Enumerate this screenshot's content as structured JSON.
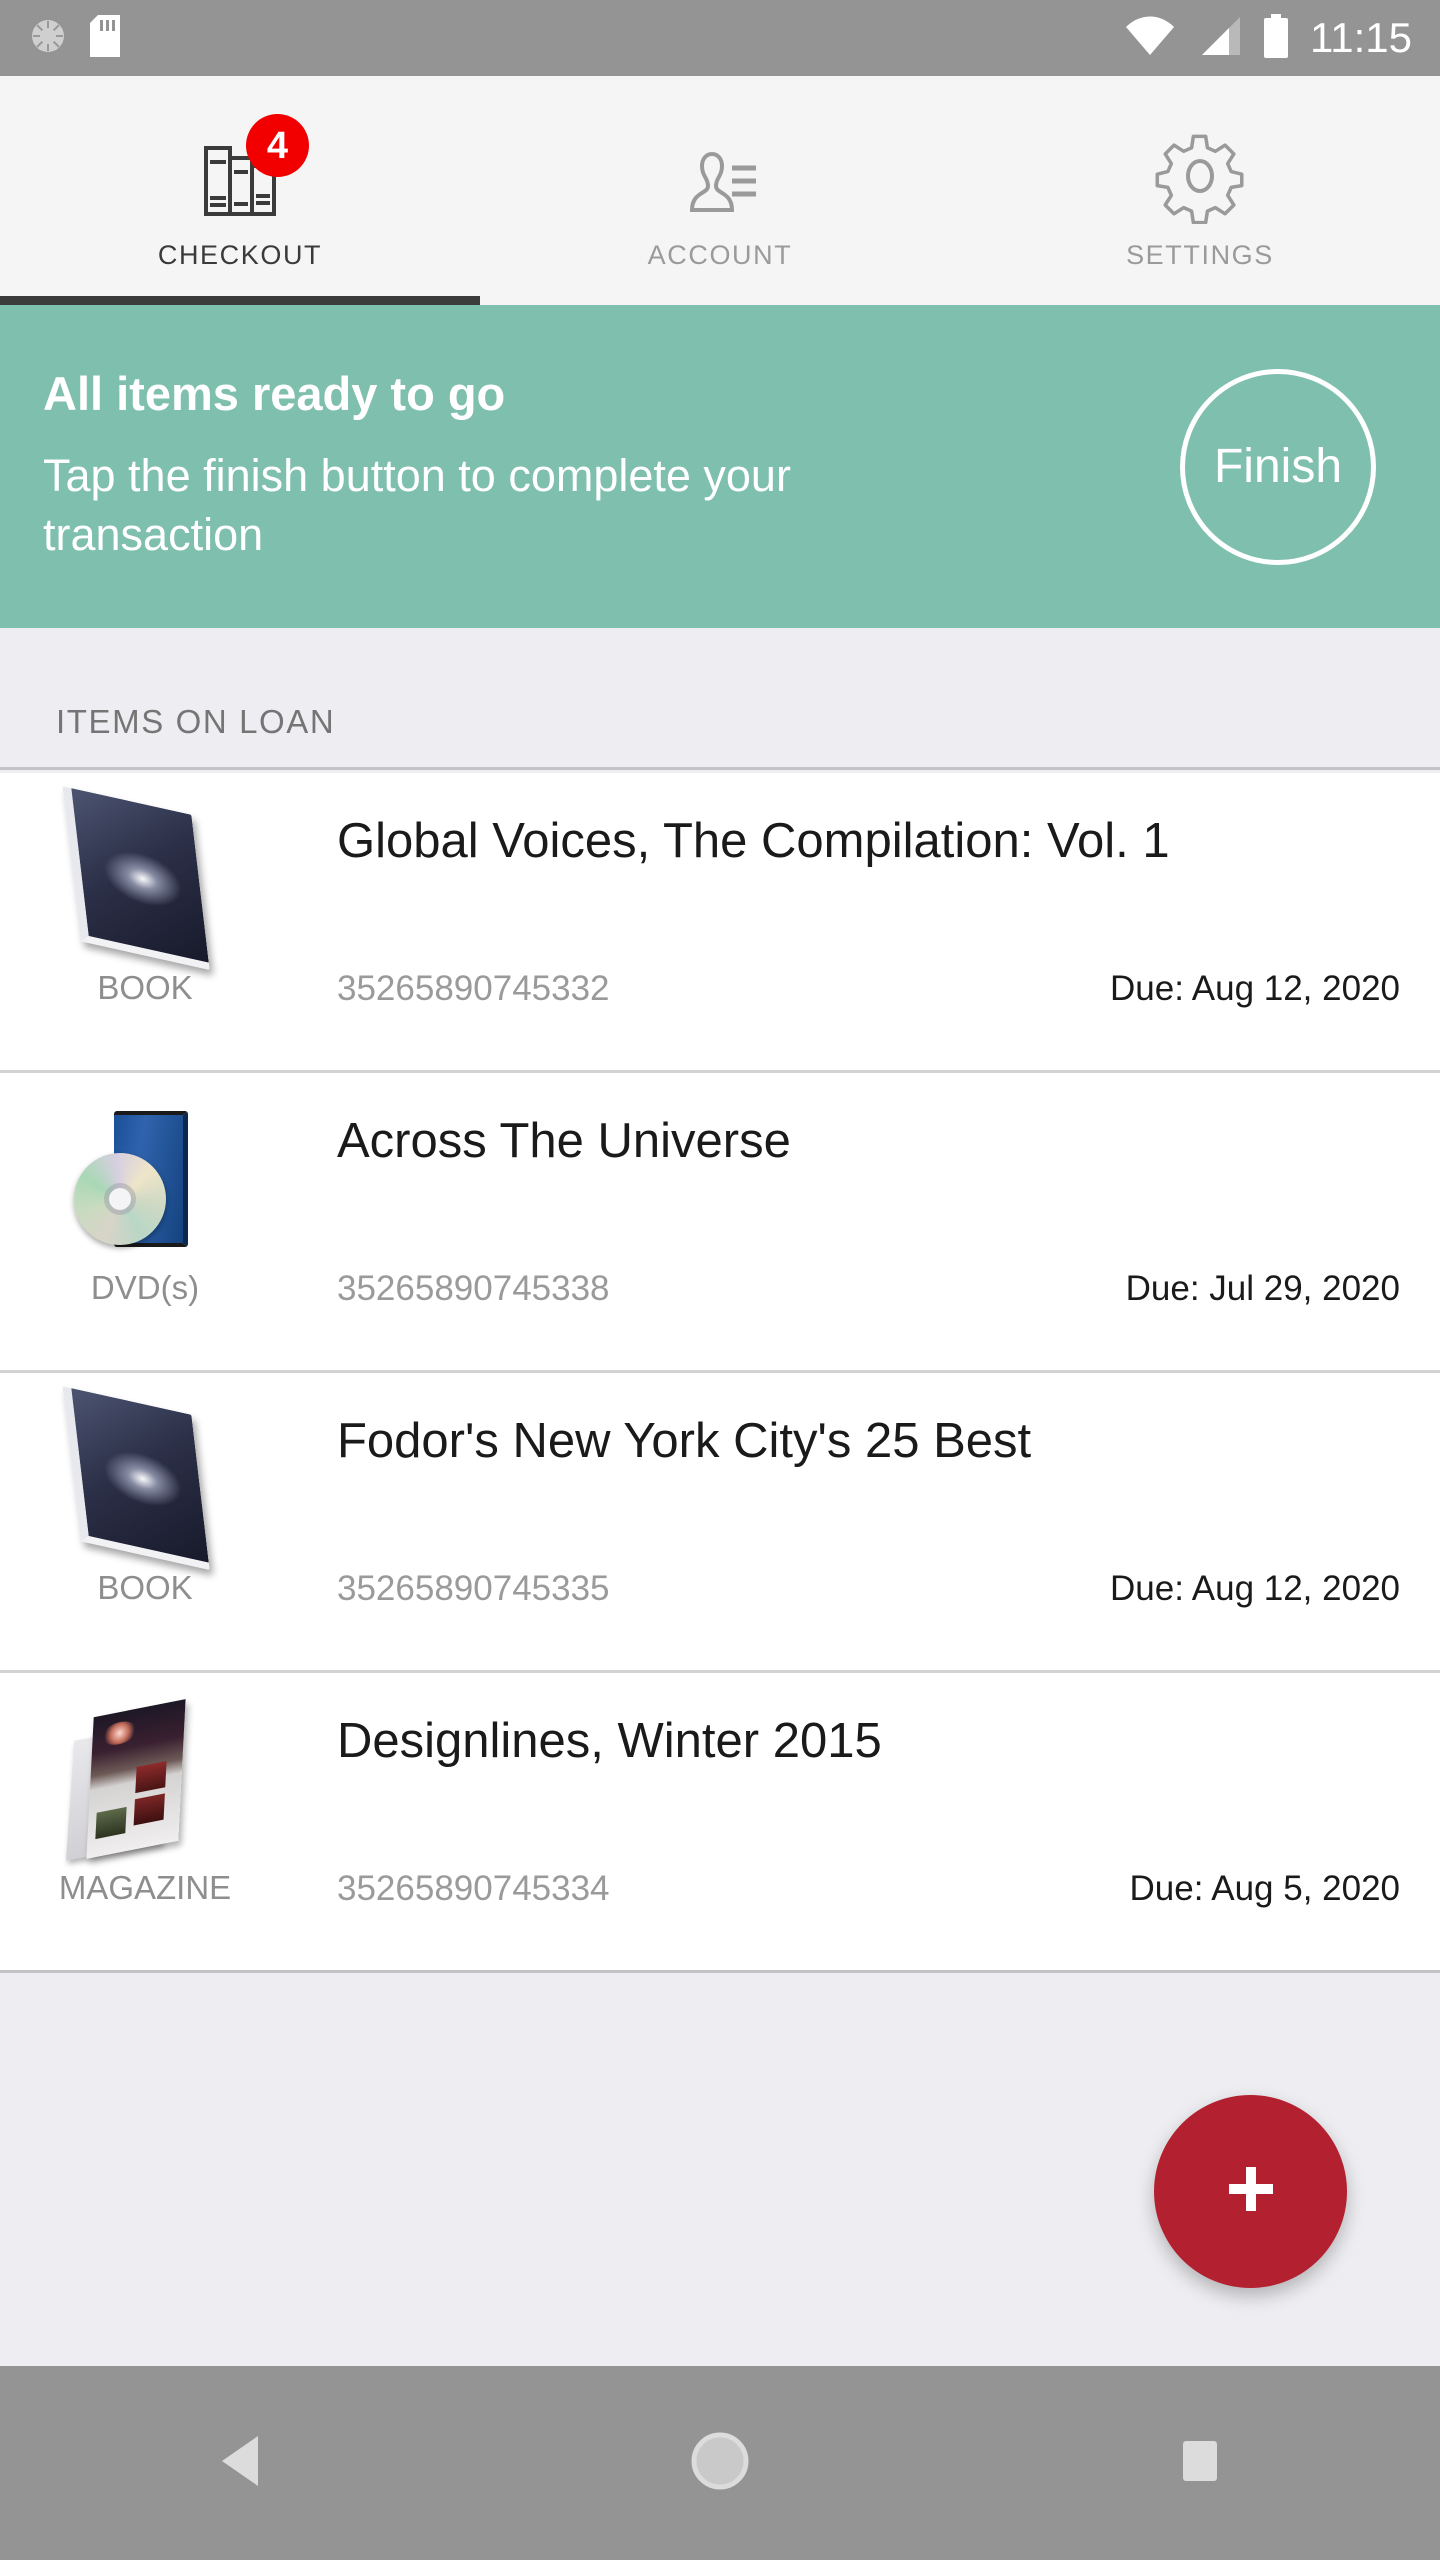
{
  "status_bar": {
    "time": "11:15",
    "icons": [
      "sync-icon",
      "sd-card-icon",
      "wifi-icon",
      "cell-signal-icon",
      "battery-icon"
    ]
  },
  "tabs": [
    {
      "label": "CHECKOUT",
      "icon": "books-icon",
      "badge": "4",
      "active": true
    },
    {
      "label": "ACCOUNT",
      "icon": "person-lines-icon",
      "badge": "",
      "active": false
    },
    {
      "label": "SETTINGS",
      "icon": "gear-icon",
      "badge": "",
      "active": false
    }
  ],
  "banner": {
    "title": "All items ready to go",
    "subtitle": "Tap the finish button to complete your transaction",
    "finish_label": "Finish",
    "color": "#7fbfad"
  },
  "section": {
    "header": "ITEMS ON LOAN"
  },
  "items": [
    {
      "title": "Global Voices, The Compilation: Vol. 1",
      "type": "BOOK",
      "barcode": "35265890745332",
      "due": "Due: Aug 12, 2020",
      "thumb": "book-cover-icon"
    },
    {
      "title": "Across The Universe",
      "type": "DVD(s)",
      "barcode": "35265890745338",
      "due": "Due: Jul 29, 2020",
      "thumb": "dvd-icon"
    },
    {
      "title": "Fodor's New York City's 25 Best",
      "type": "BOOK",
      "barcode": "35265890745335",
      "due": "Due: Aug 12, 2020",
      "thumb": "book-cover-icon"
    },
    {
      "title": "Designlines, Winter 2015",
      "type": "MAGAZINE",
      "barcode": "35265890745334",
      "due": "Due: Aug 5, 2020",
      "thumb": "magazine-icon"
    }
  ],
  "fab": {
    "icon": "plus-icon",
    "color": "#b3202f"
  },
  "nav_bar": {
    "back": "back-triangle-icon",
    "home": "home-circle-icon",
    "recents": "recents-square-icon"
  }
}
